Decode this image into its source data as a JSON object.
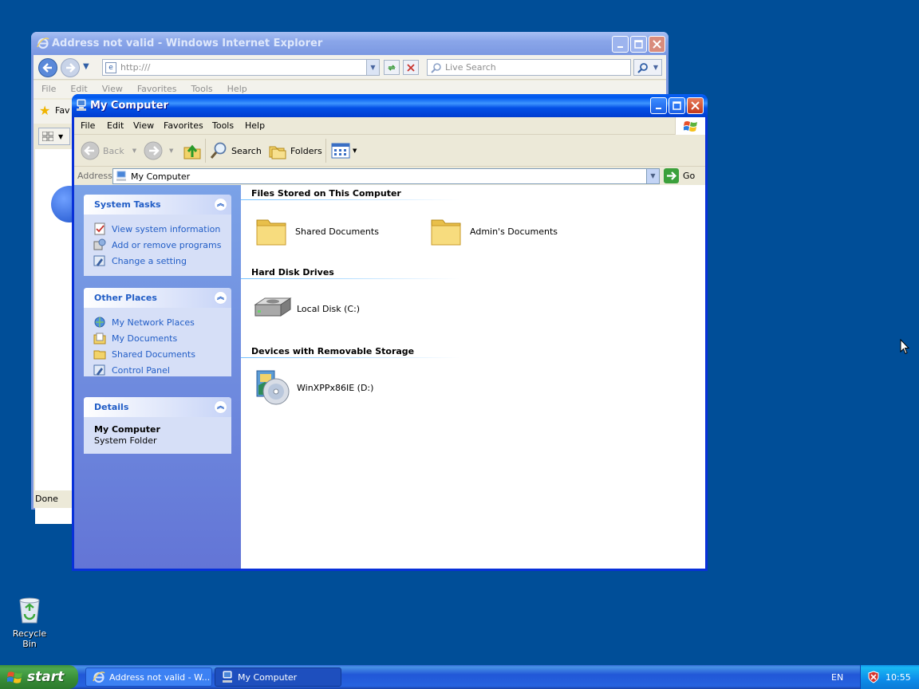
{
  "ie_window": {
    "title": "Address not valid - Windows Internet Explorer",
    "address": "http:///",
    "search_placeholder": "Live Search",
    "menu": [
      "File",
      "Edit",
      "View",
      "Favorites",
      "Tools",
      "Help"
    ],
    "favorites_label": "Fav",
    "status": "Done"
  },
  "my_computer": {
    "title": "My Computer",
    "menu": [
      "File",
      "Edit",
      "View",
      "Favorites",
      "Tools",
      "Help"
    ],
    "toolbar": {
      "back": "Back",
      "search": "Search",
      "folders": "Folders"
    },
    "address_label": "Address",
    "address_value": "My Computer",
    "go_label": "Go",
    "system_tasks": {
      "title": "System Tasks",
      "links": [
        "View system information",
        "Add or remove programs",
        "Change a setting"
      ]
    },
    "other_places": {
      "title": "Other Places",
      "links": [
        "My Network Places",
        "My Documents",
        "Shared Documents",
        "Control Panel"
      ]
    },
    "details": {
      "title": "Details",
      "name": "My Computer",
      "type": "System Folder"
    },
    "groups": {
      "files_stored": {
        "heading": "Files Stored on This Computer",
        "items": [
          "Shared Documents",
          "Admin's Documents"
        ]
      },
      "hard_disks": {
        "heading": "Hard Disk Drives",
        "items": [
          "Local Disk (C:)"
        ]
      },
      "removable": {
        "heading": "Devices with Removable Storage",
        "items": [
          "WinXPPx86IE (D:)"
        ]
      }
    }
  },
  "desktop": {
    "recycle_bin": "Recycle Bin"
  },
  "taskbar": {
    "start": "start",
    "buttons": [
      "Address not valid - W...",
      "My Computer"
    ],
    "language": "EN",
    "clock": "10:55"
  },
  "colors": {
    "desktop": "#004e98",
    "title_active": "#0058ee",
    "link": "#215dc6",
    "start_green": "#3c8f3c"
  }
}
